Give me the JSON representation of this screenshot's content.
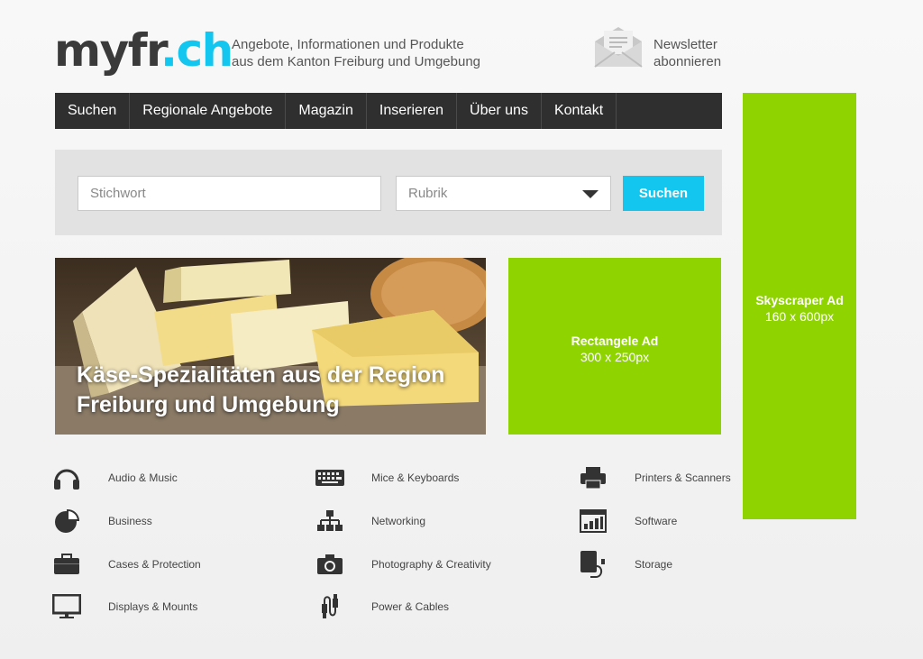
{
  "header": {
    "logo_main": "myfr",
    "logo_dot": ".",
    "logo_tld": "ch",
    "tagline_line1": "Angebote, Informationen und Produkte",
    "tagline_line2": "aus dem Kanton Freiburg und Umgebung",
    "newsletter_line1": "Newsletter",
    "newsletter_line2": "abonnieren"
  },
  "nav": {
    "items": [
      "Suchen",
      "Regionale Angebote",
      "Magazin",
      "Inserieren",
      "Über uns",
      "Kontakt"
    ]
  },
  "search": {
    "keyword_placeholder": "Stichwort",
    "category_selected": "Rubrik",
    "button_label": "Suchen"
  },
  "hero": {
    "title_line1": "Käse-Spezialitäten aus der Region",
    "title_line2": "Freiburg und Umgebung"
  },
  "ads": {
    "rectangle_title": "Rectangele Ad",
    "rectangle_size": "300 x 250px",
    "skyscraper_title": "Skyscraper Ad",
    "skyscraper_size": "160 x 600px"
  },
  "categories": [
    {
      "label": "Audio & Music",
      "icon": "headphones-icon"
    },
    {
      "label": "Mice & Keyboards",
      "icon": "keyboard-icon"
    },
    {
      "label": "Printers & Scanners",
      "icon": "printer-icon"
    },
    {
      "label": "Business",
      "icon": "pie-chart-icon"
    },
    {
      "label": "Networking",
      "icon": "network-icon"
    },
    {
      "label": "Software",
      "icon": "software-icon"
    },
    {
      "label": "Cases & Protection",
      "icon": "briefcase-icon"
    },
    {
      "label": "Photography & Creativity",
      "icon": "camera-icon"
    },
    {
      "label": "Storage",
      "icon": "hard-drive-icon"
    },
    {
      "label": "Displays & Mounts",
      "icon": "monitor-icon"
    },
    {
      "label": "Power & Cables",
      "icon": "cable-icon"
    }
  ],
  "colors": {
    "accent": "#13c6f0",
    "ad_green": "#8fd400",
    "nav_bg": "#2f2f2f"
  }
}
